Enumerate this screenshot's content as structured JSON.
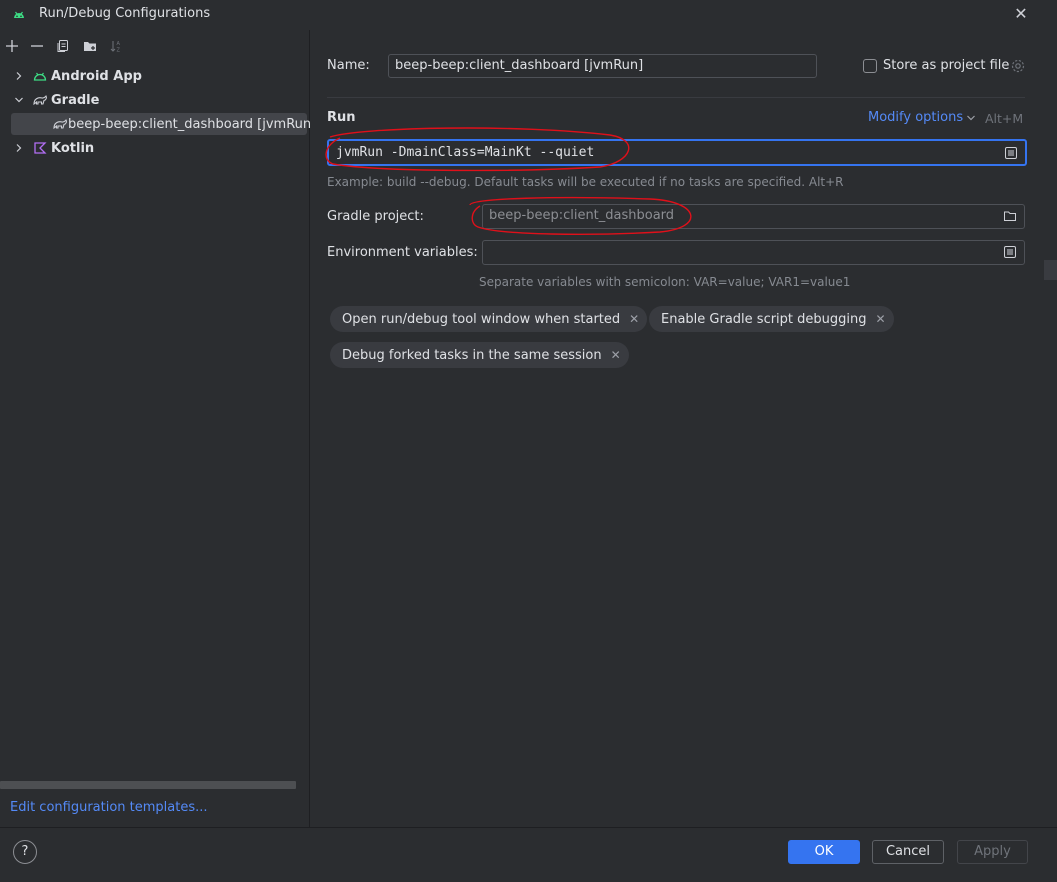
{
  "window": {
    "title": "Run/Debug Configurations"
  },
  "sidebar": {
    "items": [
      {
        "label": "Android App",
        "expanded": false
      },
      {
        "label": "Gradle",
        "expanded": true
      },
      {
        "label": "beep-beep:client_dashboard [jvmRun]",
        "selected": true
      },
      {
        "label": "Kotlin",
        "expanded": false
      }
    ],
    "edit_templates": "Edit configuration templates..."
  },
  "form": {
    "name_label": "Name:",
    "name_value": "beep-beep:client_dashboard [jvmRun]",
    "store_label": "Store as project file",
    "store_checked": false,
    "run_section": "Run",
    "modify_options": "Modify options",
    "modify_shortcut": "Alt+M",
    "run_value": "jvmRun -DmainClass=MainKt --quiet",
    "run_hint": "Example: build --debug. Default tasks will be executed if no tasks are specified. Alt+R",
    "gradle_project_label": "Gradle project:",
    "gradle_project_value": "beep-beep:client_dashboard",
    "env_label": "Environment variables:",
    "env_value": "",
    "env_hint": "Separate variables with semicolon: VAR=value; VAR1=value1"
  },
  "chips": [
    "Open run/debug tool window when started",
    "Enable Gradle script debugging",
    "Debug forked tasks in the same session"
  ],
  "footer": {
    "help": "?",
    "ok": "OK",
    "cancel": "Cancel",
    "apply": "Apply"
  },
  "colors": {
    "accent": "#3574f0",
    "link": "#548af7",
    "annotation": "#e0101a",
    "android_green": "#3ddc84",
    "kotlin_purple": "#b36ff5"
  }
}
